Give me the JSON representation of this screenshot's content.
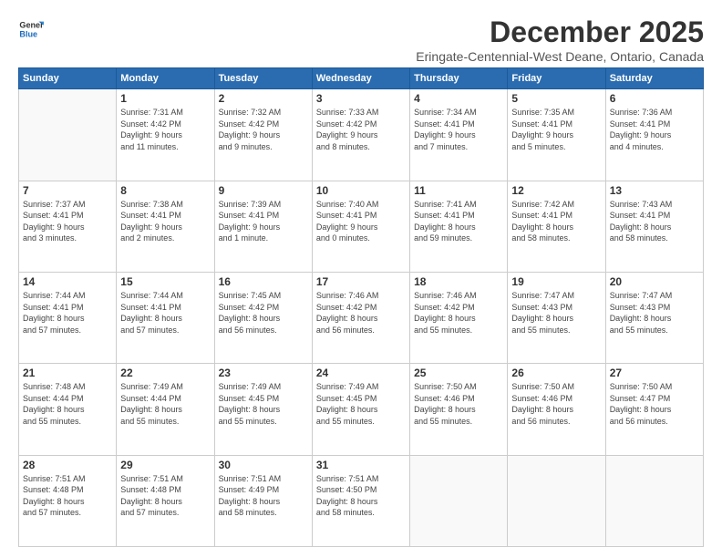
{
  "logo": {
    "line1": "General",
    "line2": "Blue"
  },
  "title": "December 2025",
  "location": "Eringate-Centennial-West Deane, Ontario, Canada",
  "weekdays": [
    "Sunday",
    "Monday",
    "Tuesday",
    "Wednesday",
    "Thursday",
    "Friday",
    "Saturday"
  ],
  "weeks": [
    [
      {
        "day": "",
        "info": ""
      },
      {
        "day": "1",
        "info": "Sunrise: 7:31 AM\nSunset: 4:42 PM\nDaylight: 9 hours\nand 11 minutes."
      },
      {
        "day": "2",
        "info": "Sunrise: 7:32 AM\nSunset: 4:42 PM\nDaylight: 9 hours\nand 9 minutes."
      },
      {
        "day": "3",
        "info": "Sunrise: 7:33 AM\nSunset: 4:42 PM\nDaylight: 9 hours\nand 8 minutes."
      },
      {
        "day": "4",
        "info": "Sunrise: 7:34 AM\nSunset: 4:41 PM\nDaylight: 9 hours\nand 7 minutes."
      },
      {
        "day": "5",
        "info": "Sunrise: 7:35 AM\nSunset: 4:41 PM\nDaylight: 9 hours\nand 5 minutes."
      },
      {
        "day": "6",
        "info": "Sunrise: 7:36 AM\nSunset: 4:41 PM\nDaylight: 9 hours\nand 4 minutes."
      }
    ],
    [
      {
        "day": "7",
        "info": "Sunrise: 7:37 AM\nSunset: 4:41 PM\nDaylight: 9 hours\nand 3 minutes."
      },
      {
        "day": "8",
        "info": "Sunrise: 7:38 AM\nSunset: 4:41 PM\nDaylight: 9 hours\nand 2 minutes."
      },
      {
        "day": "9",
        "info": "Sunrise: 7:39 AM\nSunset: 4:41 PM\nDaylight: 9 hours\nand 1 minute."
      },
      {
        "day": "10",
        "info": "Sunrise: 7:40 AM\nSunset: 4:41 PM\nDaylight: 9 hours\nand 0 minutes."
      },
      {
        "day": "11",
        "info": "Sunrise: 7:41 AM\nSunset: 4:41 PM\nDaylight: 8 hours\nand 59 minutes."
      },
      {
        "day": "12",
        "info": "Sunrise: 7:42 AM\nSunset: 4:41 PM\nDaylight: 8 hours\nand 58 minutes."
      },
      {
        "day": "13",
        "info": "Sunrise: 7:43 AM\nSunset: 4:41 PM\nDaylight: 8 hours\nand 58 minutes."
      }
    ],
    [
      {
        "day": "14",
        "info": "Sunrise: 7:44 AM\nSunset: 4:41 PM\nDaylight: 8 hours\nand 57 minutes."
      },
      {
        "day": "15",
        "info": "Sunrise: 7:44 AM\nSunset: 4:41 PM\nDaylight: 8 hours\nand 57 minutes."
      },
      {
        "day": "16",
        "info": "Sunrise: 7:45 AM\nSunset: 4:42 PM\nDaylight: 8 hours\nand 56 minutes."
      },
      {
        "day": "17",
        "info": "Sunrise: 7:46 AM\nSunset: 4:42 PM\nDaylight: 8 hours\nand 56 minutes."
      },
      {
        "day": "18",
        "info": "Sunrise: 7:46 AM\nSunset: 4:42 PM\nDaylight: 8 hours\nand 55 minutes."
      },
      {
        "day": "19",
        "info": "Sunrise: 7:47 AM\nSunset: 4:43 PM\nDaylight: 8 hours\nand 55 minutes."
      },
      {
        "day": "20",
        "info": "Sunrise: 7:47 AM\nSunset: 4:43 PM\nDaylight: 8 hours\nand 55 minutes."
      }
    ],
    [
      {
        "day": "21",
        "info": "Sunrise: 7:48 AM\nSunset: 4:44 PM\nDaylight: 8 hours\nand 55 minutes."
      },
      {
        "day": "22",
        "info": "Sunrise: 7:49 AM\nSunset: 4:44 PM\nDaylight: 8 hours\nand 55 minutes."
      },
      {
        "day": "23",
        "info": "Sunrise: 7:49 AM\nSunset: 4:45 PM\nDaylight: 8 hours\nand 55 minutes."
      },
      {
        "day": "24",
        "info": "Sunrise: 7:49 AM\nSunset: 4:45 PM\nDaylight: 8 hours\nand 55 minutes."
      },
      {
        "day": "25",
        "info": "Sunrise: 7:50 AM\nSunset: 4:46 PM\nDaylight: 8 hours\nand 55 minutes."
      },
      {
        "day": "26",
        "info": "Sunrise: 7:50 AM\nSunset: 4:46 PM\nDaylight: 8 hours\nand 56 minutes."
      },
      {
        "day": "27",
        "info": "Sunrise: 7:50 AM\nSunset: 4:47 PM\nDaylight: 8 hours\nand 56 minutes."
      }
    ],
    [
      {
        "day": "28",
        "info": "Sunrise: 7:51 AM\nSunset: 4:48 PM\nDaylight: 8 hours\nand 57 minutes."
      },
      {
        "day": "29",
        "info": "Sunrise: 7:51 AM\nSunset: 4:48 PM\nDaylight: 8 hours\nand 57 minutes."
      },
      {
        "day": "30",
        "info": "Sunrise: 7:51 AM\nSunset: 4:49 PM\nDaylight: 8 hours\nand 58 minutes."
      },
      {
        "day": "31",
        "info": "Sunrise: 7:51 AM\nSunset: 4:50 PM\nDaylight: 8 hours\nand 58 minutes."
      },
      {
        "day": "",
        "info": ""
      },
      {
        "day": "",
        "info": ""
      },
      {
        "day": "",
        "info": ""
      }
    ]
  ]
}
